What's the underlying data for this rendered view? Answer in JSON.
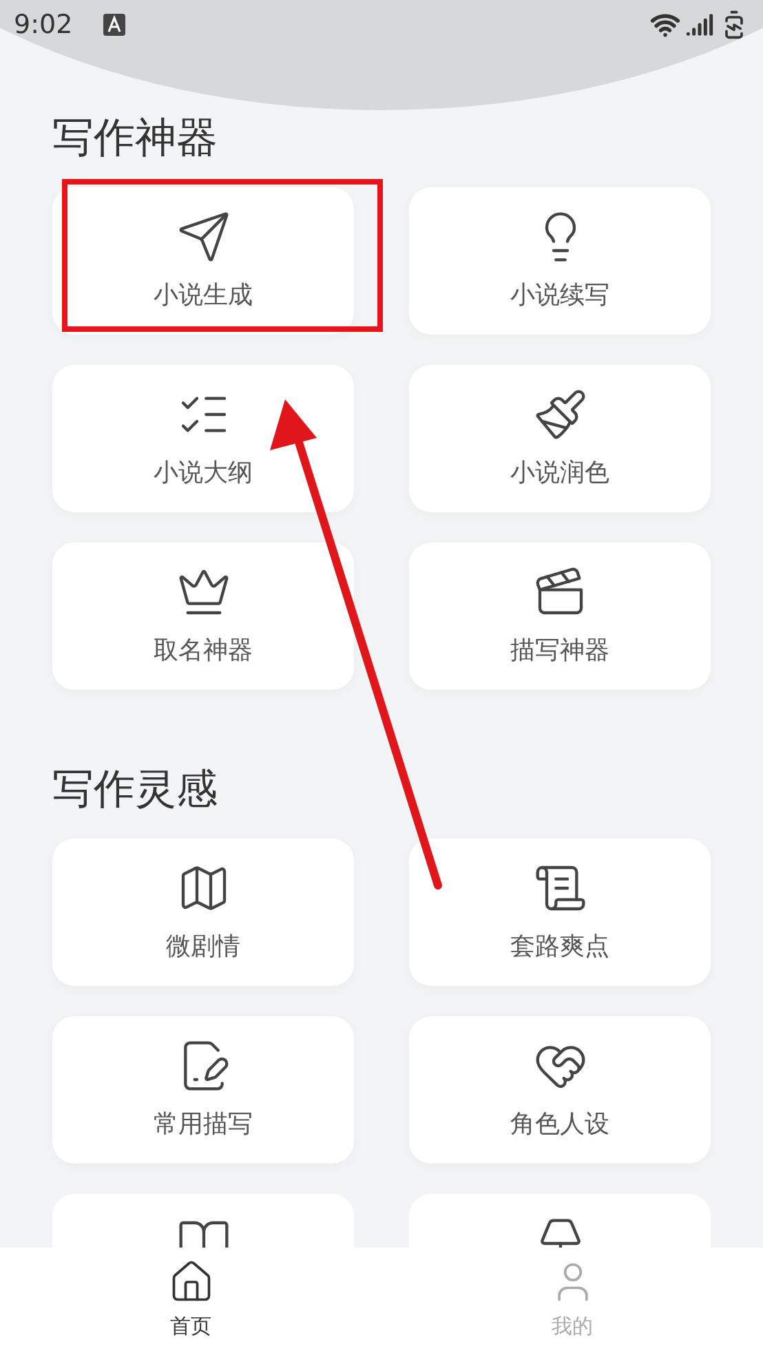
{
  "status_bar": {
    "time": "9:02"
  },
  "sections": [
    {
      "title": "写作神器",
      "items": [
        {
          "kind": "tool",
          "label": "小说生成"
        },
        {
          "kind": "tool",
          "label": "小说续写"
        },
        {
          "kind": "tool",
          "label": "小说大纲"
        },
        {
          "kind": "tool",
          "label": "小说润色"
        },
        {
          "kind": "tool",
          "label": "取名神器"
        },
        {
          "kind": "tool",
          "label": "描写神器"
        }
      ]
    },
    {
      "title": "写作灵感",
      "items": [
        {
          "kind": "tool",
          "label": "微剧情"
        },
        {
          "kind": "tool",
          "label": "套路爽点"
        },
        {
          "kind": "tool",
          "label": "常用描写"
        },
        {
          "kind": "tool",
          "label": "角色人设"
        },
        {
          "kind": "partial"
        },
        {
          "kind": "partial"
        }
      ]
    }
  ],
  "bottom_nav": [
    {
      "label": "首页",
      "selected": true
    },
    {
      "label": "我的",
      "selected": false
    }
  ],
  "annotations": {
    "highlight_box": true,
    "arrow": true
  }
}
